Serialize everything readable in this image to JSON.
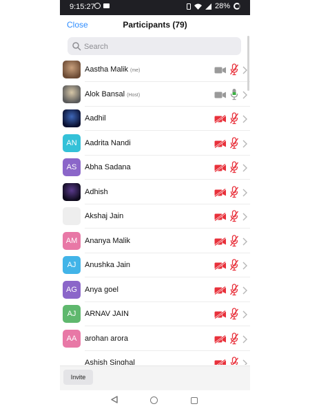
{
  "status_bar": {
    "time": "9:15:27",
    "battery": "28%"
  },
  "header": {
    "close_label": "Close",
    "title": "Participants (79)"
  },
  "search": {
    "placeholder": "Search"
  },
  "participants": [
    {
      "name": "Aastha Malik",
      "role": "(me)",
      "avatar_type": "photo",
      "photo_colors": [
        "#6b4a34",
        "#c9a07c"
      ],
      "camera": "off-gray",
      "mic": "muted-red"
    },
    {
      "name": "Alok Bansal",
      "role": "(Host)",
      "avatar_type": "photo",
      "photo_colors": [
        "#5a5a5a",
        "#d7c7a8"
      ],
      "camera": "off-gray",
      "mic": "unmuted-green"
    },
    {
      "name": "Aadhil",
      "role": "",
      "avatar_type": "photo",
      "photo_colors": [
        "#0a1030",
        "#3e67b8"
      ],
      "camera": "off-red",
      "mic": "muted-red"
    },
    {
      "name": "Aadrita Nandi",
      "role": "",
      "avatar_type": "initials",
      "initials": "AN",
      "color": "#34c1d8",
      "camera": "off-red",
      "mic": "muted-red"
    },
    {
      "name": "Abha Sadana",
      "role": "",
      "avatar_type": "initials",
      "initials": "AS",
      "color": "#8b66c9",
      "camera": "off-red",
      "mic": "muted-red"
    },
    {
      "name": "Adhish",
      "role": "",
      "avatar_type": "photo",
      "photo_colors": [
        "#0e0a1c",
        "#5a3a8c"
      ],
      "camera": "off-red",
      "mic": "muted-red"
    },
    {
      "name": "Akshaj Jain",
      "role": "",
      "avatar_type": "blank",
      "color": "#eeeeee",
      "camera": "off-red",
      "mic": "muted-red"
    },
    {
      "name": "Ananya Malik",
      "role": "",
      "avatar_type": "initials",
      "initials": "AM",
      "color": "#e878a6",
      "camera": "off-red",
      "mic": "muted-red"
    },
    {
      "name": "Anushka Jain",
      "role": "",
      "avatar_type": "initials",
      "initials": "AJ",
      "color": "#42b4e8",
      "camera": "off-red",
      "mic": "muted-red"
    },
    {
      "name": "Anya goel",
      "role": "",
      "avatar_type": "initials",
      "initials": "AG",
      "color": "#8b66c9",
      "camera": "off-red",
      "mic": "muted-red"
    },
    {
      "name": "ARNAV JAIN",
      "role": "",
      "avatar_type": "initials",
      "initials": "AJ",
      "color": "#5fb86e",
      "camera": "off-red",
      "mic": "muted-red"
    },
    {
      "name": "arohan arora",
      "role": "",
      "avatar_type": "initials",
      "initials": "AA",
      "color": "#e878a6",
      "camera": "off-red",
      "mic": "muted-red"
    },
    {
      "name": "Ashish Singhal",
      "role": "",
      "avatar_type": "blank",
      "color": "#ffffff",
      "camera": "off-red",
      "mic": "muted-red"
    }
  ],
  "footer": {
    "invite_label": "Invite"
  },
  "colors": {
    "accent": "#2d8cff",
    "muted_red": "#e8313b",
    "unmuted_green": "#3cb043",
    "gray_icon": "#9a9a9a"
  }
}
